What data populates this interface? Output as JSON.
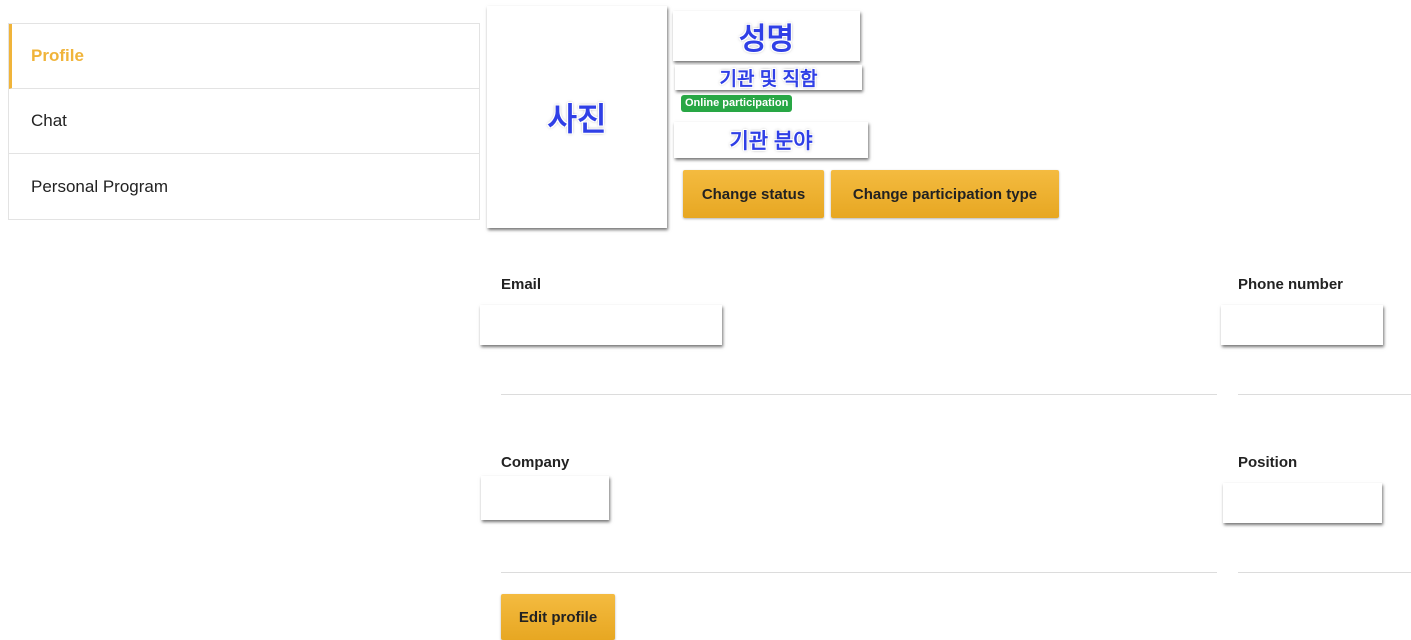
{
  "sidebar": {
    "items": [
      {
        "label": "Profile"
      },
      {
        "label": "Chat"
      },
      {
        "label": "Personal Program"
      }
    ]
  },
  "profile": {
    "photo_label": "사진",
    "name": "성명",
    "organization_title": "기관 및 직함",
    "participation_badge": "Online participation",
    "field": "기관 분야",
    "change_status_label": "Change status",
    "change_participation_label": "Change participation type"
  },
  "form": {
    "email_label": "Email",
    "email_value": "",
    "phone_label": "Phone number",
    "phone_value": "",
    "company_label": "Company",
    "company_value": "",
    "position_label": "Position",
    "position_value": "",
    "edit_label": "Edit profile"
  },
  "colors": {
    "accent": "#f0b43a",
    "button": "#f0b43a",
    "badge": "#28a745",
    "korean_text": "#2f3fe6"
  }
}
